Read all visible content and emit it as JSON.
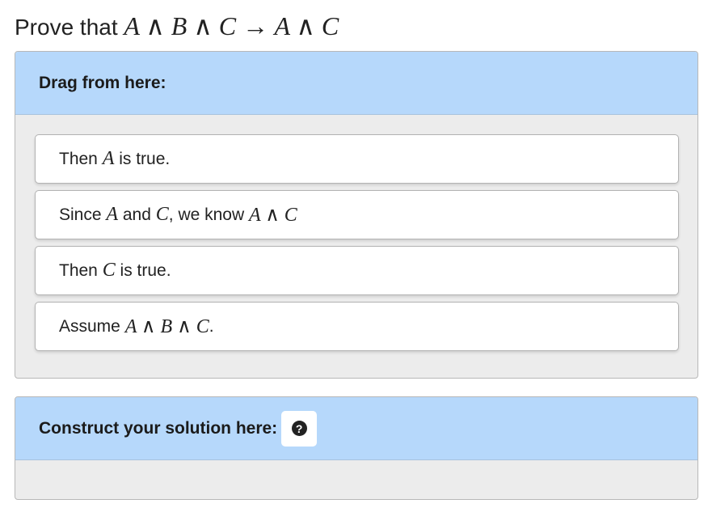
{
  "prompt": {
    "prefix": "Prove that ",
    "formula": "A ∧ B ∧ C → A ∧ C"
  },
  "source_panel": {
    "heading": "Drag from here:",
    "items": [
      {
        "t0": "Then ",
        "m0": "A",
        "t1": " is true.",
        "m1": "",
        "t2": "",
        "m2": "",
        "t3": ""
      },
      {
        "t0": "Since ",
        "m0": "A",
        "t1": " and ",
        "m1": "C",
        "t2": ", we know ",
        "m2": "A ∧ C",
        "t3": ""
      },
      {
        "t0": "Then ",
        "m0": "C",
        "t1": " is true.",
        "m1": "",
        "t2": "",
        "m2": "",
        "t3": ""
      },
      {
        "t0": "Assume ",
        "m0": "A ∧ B ∧ C",
        "t1": ".",
        "m1": "",
        "t2": "",
        "m2": "",
        "t3": ""
      }
    ]
  },
  "target_panel": {
    "heading": "Construct your solution here:",
    "help_icon": "question-circle-icon",
    "help_glyph": "?"
  },
  "colors": {
    "header_bg": "#b6d8fb",
    "panel_bg": "#ececec",
    "item_bg": "#ffffff"
  }
}
